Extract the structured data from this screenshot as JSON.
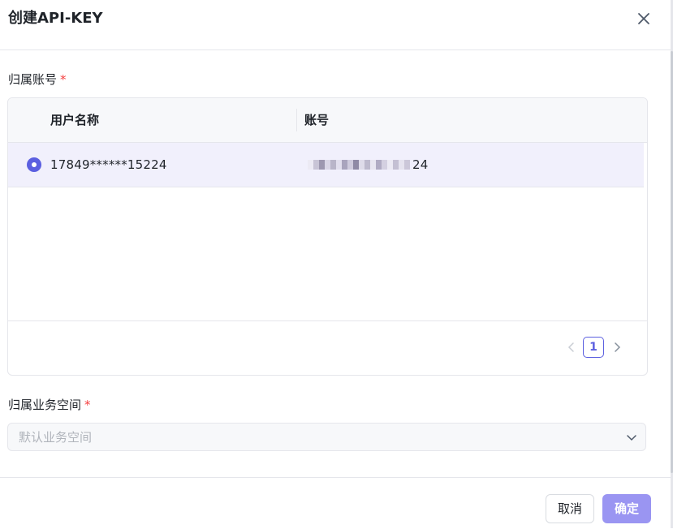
{
  "dialog": {
    "title": "创建API-KEY",
    "close_icon": "close-icon"
  },
  "account_field": {
    "label": "归属账号",
    "required_mark": "*",
    "table": {
      "columns": [
        "用户名称",
        "账号"
      ],
      "rows": [
        {
          "selected": true,
          "user_name": "17849******15224",
          "account_suffix": "24"
        }
      ]
    },
    "pagination": {
      "prev_icon": "chevron-left-icon",
      "current_page": "1",
      "next_icon": "chevron-right-icon"
    }
  },
  "workspace_field": {
    "label": "归属业务空间",
    "required_mark": "*",
    "placeholder": "默认业务空间",
    "arrow_icon": "chevron-down-icon"
  },
  "footer": {
    "cancel_label": "取消",
    "confirm_label": "确定"
  },
  "colors": {
    "accent": "#5b5fe0",
    "selected_row": "#f1f0fc",
    "confirm_button": "#9a95f2",
    "required": "#f53f3f"
  }
}
